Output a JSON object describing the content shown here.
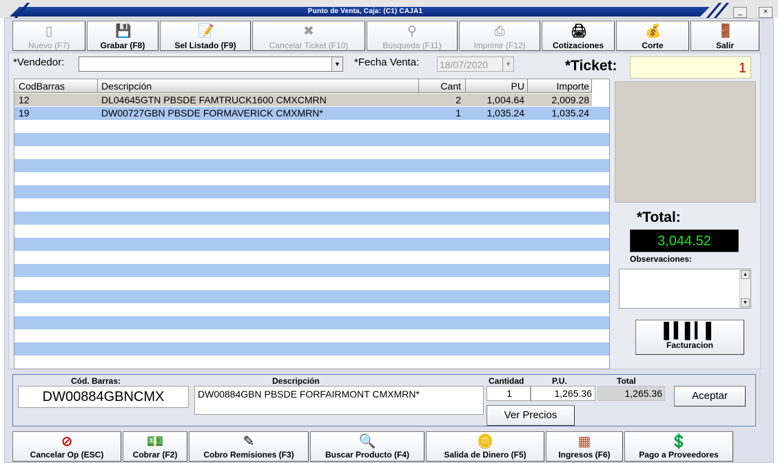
{
  "window": {
    "title": "Punto de Venta,   Caja: (C1) CAJA1",
    "minimize": "_",
    "close": "×"
  },
  "toolbar": [
    {
      "label": "Nuevo (F7)",
      "icon": "document-icon",
      "glyph": "▯",
      "enabled": false
    },
    {
      "label": "Grabar (F8)",
      "icon": "save-icon",
      "glyph": "💾",
      "enabled": true
    },
    {
      "label": "Sel Listado (F9)",
      "icon": "notepad-icon",
      "glyph": "📝",
      "enabled": true
    },
    {
      "label": "Cancelar Ticket (F10)",
      "icon": "cancel-ticket-icon",
      "glyph": "✖",
      "enabled": false
    },
    {
      "label": "Búsqueda (F11)",
      "icon": "search-tool-icon",
      "glyph": "⚲",
      "enabled": false
    },
    {
      "label": "Imprimir (F12)",
      "icon": "printer-icon",
      "glyph": "⎙",
      "enabled": false
    },
    {
      "label": "Cotizaciones",
      "icon": "quote-printer-icon",
      "glyph": "🖨",
      "enabled": true
    },
    {
      "label": "Corte",
      "icon": "money-cut-icon",
      "glyph": "💰",
      "enabled": true
    },
    {
      "label": "Salir",
      "icon": "exit-door-icon",
      "glyph": "🚪",
      "enabled": true
    }
  ],
  "form": {
    "vendedor_label": "*Vendedor:",
    "vendedor_value": "",
    "fecha_label": "*Fecha Venta:",
    "fecha_value": "18/07/2020",
    "ticket_label": "*Ticket:",
    "ticket_value": "1"
  },
  "grid": {
    "columns": [
      "CodBarras",
      "Descripción",
      "Cant",
      "PU",
      "Importe"
    ],
    "rows": [
      {
        "cod": "12",
        "desc": "DL04645GTN PBSDE FAMTRUCK1600 CMXCMRN",
        "cant": "2",
        "pu": "1,004.64",
        "importe": "2,009.28"
      },
      {
        "cod": "19",
        "desc": "DW00727GBN PBSDE FORMAVERICK CMXMRN*",
        "cant": "1",
        "pu": "1,035.24",
        "importe": "1,035.24"
      }
    ]
  },
  "totals": {
    "total_label": "*Total:",
    "total_value": "3,044.52",
    "observaciones_label": "Observaciones:",
    "observaciones_value": "",
    "facturacion_label": "Facturacion"
  },
  "entry": {
    "cod_label": "Cód. Barras:",
    "cod_value": "DW00884GBNCMX",
    "desc_label": "Descripción",
    "desc_value": "DW00884GBN PBSDE FORFAIRMONT CMXMRN*",
    "cant_label": "Cantidad",
    "cant_value": "1",
    "pu_label": "P.U.",
    "pu_value": "1,265.36",
    "total_label": "Total",
    "total_value": "1,265.36",
    "aceptar_label": "Aceptar",
    "ver_precios_label": "Ver Precios"
  },
  "bottom_toolbar": [
    {
      "label": "Cancelar Op (ESC)",
      "icon": "no-entry-icon",
      "glyph": "⊘"
    },
    {
      "label": "Cobrar (F2)",
      "icon": "cash-icon",
      "glyph": "💵"
    },
    {
      "label": "Cobro Remisiones (F3)",
      "icon": "edit-document-icon",
      "glyph": "✎"
    },
    {
      "label": "Buscar Producto (F4)",
      "icon": "magnifier-icon",
      "glyph": "🔍"
    },
    {
      "label": "Salida de Dinero (F5)",
      "icon": "coins-icon",
      "glyph": "🪙"
    },
    {
      "label": "Ingresos (F6)",
      "icon": "income-boxes-icon",
      "glyph": "▦"
    },
    {
      "label": "Pago a Proveedores",
      "icon": "payment-icon",
      "glyph": "💲"
    }
  ],
  "colors": {
    "accent": "#0a2a7c",
    "row_selected": "#a9c8f2",
    "total_text": "#19e619",
    "ticket_text": "#c00000"
  }
}
